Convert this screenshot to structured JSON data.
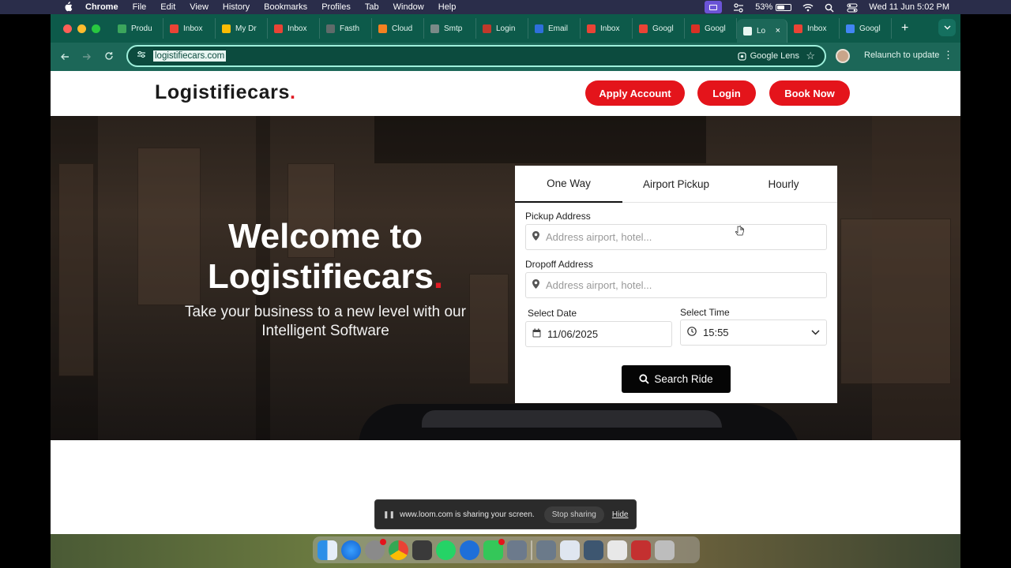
{
  "menubar": {
    "apple": "",
    "app": "Chrome",
    "items": [
      "File",
      "Edit",
      "View",
      "History",
      "Bookmarks",
      "Profiles",
      "Tab",
      "Window",
      "Help"
    ],
    "battery": "53%",
    "battery_level": 0.53,
    "datetime": "Wed 11 Jun  5:02 PM"
  },
  "tabs": [
    {
      "label": "Produ",
      "icon": "gem-icon",
      "color": "#3ba55c"
    },
    {
      "label": "Inbox",
      "icon": "gmail-icon",
      "color": "#ea4335"
    },
    {
      "label": "My Dr",
      "icon": "drive-icon",
      "color": "#fbbc04"
    },
    {
      "label": "Inbox",
      "icon": "gmail-icon",
      "color": "#ea4335"
    },
    {
      "label": "Fasth",
      "icon": "slash-icon",
      "color": "#5f6b6a"
    },
    {
      "label": "Cloud",
      "icon": "cloud-icon",
      "color": "#f48120"
    },
    {
      "label": "Smtp",
      "icon": "globe-icon",
      "color": "#7a8a88"
    },
    {
      "label": "Login",
      "icon": "circle-icon",
      "color": "#c0392b"
    },
    {
      "label": "Email",
      "icon": "mail-icon",
      "color": "#2e6fdb"
    },
    {
      "label": "Inbox",
      "icon": "gmail-icon",
      "color": "#ea4335"
    },
    {
      "label": "Googl",
      "icon": "gmail-icon",
      "color": "#ea4335"
    },
    {
      "label": "Googl",
      "icon": "red-doc-icon",
      "color": "#d93025"
    },
    {
      "label": "Lo",
      "icon": "doc-icon",
      "color": "#ffffff",
      "active": true
    },
    {
      "label": "Inbox",
      "icon": "gmail-icon",
      "color": "#ea4335"
    },
    {
      "label": "Googl",
      "icon": "google-icon",
      "color": "#4285f4"
    }
  ],
  "toolbar": {
    "url": "logistifiecars.com",
    "lens": "Google Lens",
    "relaunch": "Relaunch to update"
  },
  "site": {
    "logo_text": "Logistifiecars",
    "logo_dot": ".",
    "apply_label": "Apply Account",
    "login_label": "Login",
    "book_label": "Book Now",
    "welcome_line1": "Welcome to",
    "welcome_line2": "Logistifiecars",
    "welcome_dot": ".",
    "subtitle": "Take your business to a new level with our Intelligent Software"
  },
  "booking": {
    "tabs": [
      "One Way",
      "Airport Pickup",
      "Hourly"
    ],
    "pickup_label": "Pickup Address",
    "pickup_placeholder": "Address airport, hotel...",
    "dropoff_label": "Dropoff Address",
    "dropoff_placeholder": "Address airport, hotel...",
    "date_label": "Select Date",
    "date_value": "11/06/2025",
    "time_label": "Select Time",
    "time_value": "15:55",
    "search_label": "Search Ride"
  },
  "share_bar": {
    "message": "www.loom.com is sharing your screen.",
    "stop": "Stop sharing",
    "hide": "Hide"
  },
  "colors": {
    "accent_red": "#e4141b",
    "chrome_green": "#1c6758",
    "omnibox_border": "#9ff0dc"
  }
}
